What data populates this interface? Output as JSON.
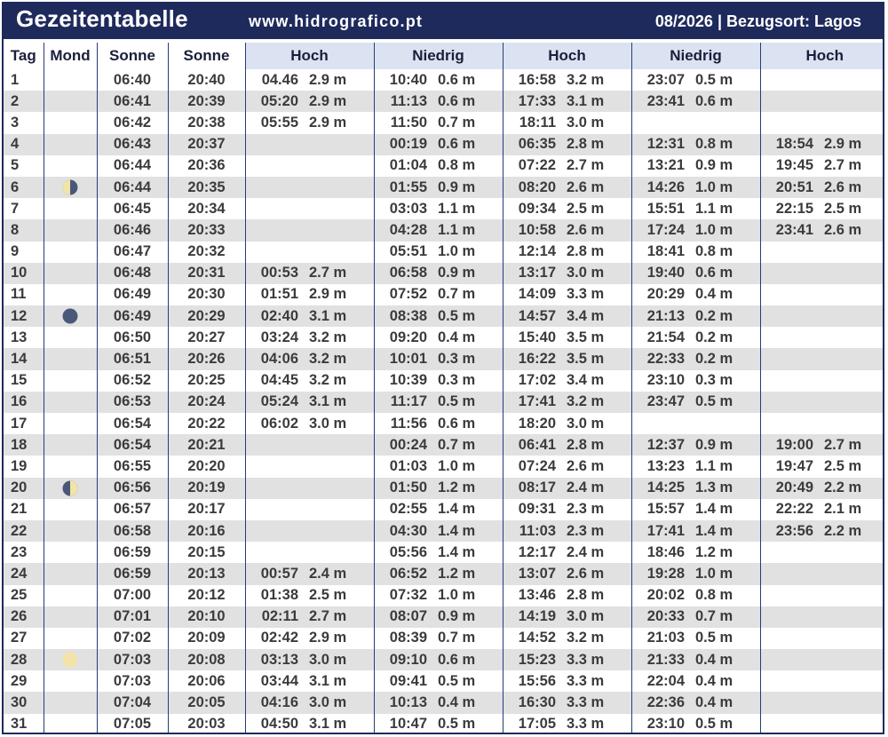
{
  "header": {
    "title": "Gezeitentabelle",
    "website": "www.hidrografico.pt",
    "info": "08/2026 | Bezugsort: Lagos"
  },
  "columns": [
    "Tag",
    "Mond",
    "Sonne",
    "Sonne",
    "Hoch",
    "Niedrig",
    "Hoch",
    "Niedrig",
    "Hoch"
  ],
  "colors": {
    "navy": "#1e2a5c",
    "header_bg": "#dbe3f2",
    "row_alt": "#e1e1e1",
    "moon_dark": "#4a5878",
    "moon_light": "#f2e3a8"
  },
  "rows": [
    {
      "day": "1",
      "moon": "",
      "sunrise": "06:40",
      "sunset": "20:40",
      "tides": [
        [
          "04.46",
          "2.9 m"
        ],
        [
          "10:40",
          "0.6 m"
        ],
        [
          "16:58",
          "3.2 m"
        ],
        [
          "23:07",
          "0.5 m"
        ],
        [
          "",
          ""
        ]
      ]
    },
    {
      "day": "2",
      "moon": "",
      "sunrise": "06:41",
      "sunset": "20:39",
      "tides": [
        [
          "05:20",
          "2.9 m"
        ],
        [
          "11:13",
          "0.6 m"
        ],
        [
          "17:33",
          "3.1 m"
        ],
        [
          "23:41",
          "0.6 m"
        ],
        [
          "",
          ""
        ]
      ]
    },
    {
      "day": "3",
      "moon": "",
      "sunrise": "06:42",
      "sunset": "20:38",
      "tides": [
        [
          "05:55",
          "2.9 m"
        ],
        [
          "11:50",
          "0.7 m"
        ],
        [
          "18:11",
          "3.0 m"
        ],
        [
          "",
          ""
        ],
        [
          "",
          ""
        ]
      ]
    },
    {
      "day": "4",
      "moon": "",
      "sunrise": "06:43",
      "sunset": "20:37",
      "tides": [
        [
          "",
          ""
        ],
        [
          "00:19",
          "0.6 m"
        ],
        [
          "06:35",
          "2.8 m"
        ],
        [
          "12:31",
          "0.8 m"
        ],
        [
          "18:54",
          "2.9 m"
        ]
      ]
    },
    {
      "day": "5",
      "moon": "",
      "sunrise": "06:44",
      "sunset": "20:36",
      "tides": [
        [
          "",
          ""
        ],
        [
          "01:04",
          "0.8 m"
        ],
        [
          "07:22",
          "2.7 m"
        ],
        [
          "13:21",
          "0.9 m"
        ],
        [
          "19:45",
          "2.7 m"
        ]
      ]
    },
    {
      "day": "6",
      "moon": "last-quarter",
      "sunrise": "06:44",
      "sunset": "20:35",
      "tides": [
        [
          "",
          ""
        ],
        [
          "01:55",
          "0.9 m"
        ],
        [
          "08:20",
          "2.6 m"
        ],
        [
          "14:26",
          "1.0 m"
        ],
        [
          "20:51",
          "2.6 m"
        ]
      ]
    },
    {
      "day": "7",
      "moon": "",
      "sunrise": "06:45",
      "sunset": "20:34",
      "tides": [
        [
          "",
          ""
        ],
        [
          "03:03",
          "1.1 m"
        ],
        [
          "09:34",
          "2.5 m"
        ],
        [
          "15:51",
          "1.1 m"
        ],
        [
          "22:15",
          "2.5 m"
        ]
      ]
    },
    {
      "day": "8",
      "moon": "",
      "sunrise": "06:46",
      "sunset": "20:33",
      "tides": [
        [
          "",
          ""
        ],
        [
          "04:28",
          "1.1 m"
        ],
        [
          "10:58",
          "2.6 m"
        ],
        [
          "17:24",
          "1.0 m"
        ],
        [
          "23:41",
          "2.6 m"
        ]
      ]
    },
    {
      "day": "9",
      "moon": "",
      "sunrise": "06:47",
      "sunset": "20:32",
      "tides": [
        [
          "",
          ""
        ],
        [
          "05:51",
          "1.0 m"
        ],
        [
          "12:14",
          "2.8 m"
        ],
        [
          "18:41",
          "0.8 m"
        ],
        [
          "",
          ""
        ]
      ]
    },
    {
      "day": "10",
      "moon": "",
      "sunrise": "06:48",
      "sunset": "20:31",
      "tides": [
        [
          "00:53",
          "2.7 m"
        ],
        [
          "06:58",
          "0.9 m"
        ],
        [
          "13:17",
          "3.0 m"
        ],
        [
          "19:40",
          "0.6 m"
        ],
        [
          "",
          ""
        ]
      ]
    },
    {
      "day": "11",
      "moon": "",
      "sunrise": "06:49",
      "sunset": "20:30",
      "tides": [
        [
          "01:51",
          "2.9 m"
        ],
        [
          "07:52",
          "0.7 m"
        ],
        [
          "14:09",
          "3.3 m"
        ],
        [
          "20:29",
          "0.4 m"
        ],
        [
          "",
          ""
        ]
      ]
    },
    {
      "day": "12",
      "moon": "new",
      "sunrise": "06:49",
      "sunset": "20:29",
      "tides": [
        [
          "02:40",
          "3.1 m"
        ],
        [
          "08:38",
          "0.5 m"
        ],
        [
          "14:57",
          "3.4 m"
        ],
        [
          "21:13",
          "0.2 m"
        ],
        [
          "",
          ""
        ]
      ]
    },
    {
      "day": "13",
      "moon": "",
      "sunrise": "06:50",
      "sunset": "20:27",
      "tides": [
        [
          "03:24",
          "3.2 m"
        ],
        [
          "09:20",
          "0.4 m"
        ],
        [
          "15:40",
          "3.5 m"
        ],
        [
          "21:54",
          "0.2 m"
        ],
        [
          "",
          ""
        ]
      ]
    },
    {
      "day": "14",
      "moon": "",
      "sunrise": "06:51",
      "sunset": "20:26",
      "tides": [
        [
          "04:06",
          "3.2 m"
        ],
        [
          "10:01",
          "0.3 m"
        ],
        [
          "16:22",
          "3.5 m"
        ],
        [
          "22:33",
          "0.2 m"
        ],
        [
          "",
          ""
        ]
      ]
    },
    {
      "day": "15",
      "moon": "",
      "sunrise": "06:52",
      "sunset": "20:25",
      "tides": [
        [
          "04:45",
          "3.2 m"
        ],
        [
          "10:39",
          "0.3 m"
        ],
        [
          "17:02",
          "3.4 m"
        ],
        [
          "23:10",
          "0.3 m"
        ],
        [
          "",
          ""
        ]
      ]
    },
    {
      "day": "16",
      "moon": "",
      "sunrise": "06:53",
      "sunset": "20:24",
      "tides": [
        [
          "05:24",
          "3.1 m"
        ],
        [
          "11:17",
          "0.5 m"
        ],
        [
          "17:41",
          "3.2 m"
        ],
        [
          "23:47",
          "0.5 m"
        ],
        [
          "",
          ""
        ]
      ]
    },
    {
      "day": "17",
      "moon": "",
      "sunrise": "06:54",
      "sunset": "20:22",
      "tides": [
        [
          "06:02",
          "3.0 m"
        ],
        [
          "11:56",
          "0.6 m"
        ],
        [
          "18:20",
          "3.0 m"
        ],
        [
          "",
          ""
        ],
        [
          "",
          ""
        ]
      ]
    },
    {
      "day": "18",
      "moon": "",
      "sunrise": "06:54",
      "sunset": "20:21",
      "tides": [
        [
          "",
          ""
        ],
        [
          "00:24",
          "0.7 m"
        ],
        [
          "06:41",
          "2.8 m"
        ],
        [
          "12:37",
          "0.9 m"
        ],
        [
          "19:00",
          "2.7 m"
        ]
      ]
    },
    {
      "day": "19",
      "moon": "",
      "sunrise": "06:55",
      "sunset": "20:20",
      "tides": [
        [
          "",
          ""
        ],
        [
          "01:03",
          "1.0 m"
        ],
        [
          "07:24",
          "2.6 m"
        ],
        [
          "13:23",
          "1.1 m"
        ],
        [
          "19:47",
          "2.5 m"
        ]
      ]
    },
    {
      "day": "20",
      "moon": "first-quarter",
      "sunrise": "06:56",
      "sunset": "20:19",
      "tides": [
        [
          "",
          ""
        ],
        [
          "01:50",
          "1.2 m"
        ],
        [
          "08:17",
          "2.4 m"
        ],
        [
          "14:25",
          "1.3 m"
        ],
        [
          "20:49",
          "2.2 m"
        ]
      ]
    },
    {
      "day": "21",
      "moon": "",
      "sunrise": "06:57",
      "sunset": "20:17",
      "tides": [
        [
          "",
          ""
        ],
        [
          "02:55",
          "1.4 m"
        ],
        [
          "09:31",
          "2.3 m"
        ],
        [
          "15:57",
          "1.4 m"
        ],
        [
          "22:22",
          "2.1 m"
        ]
      ]
    },
    {
      "day": "22",
      "moon": "",
      "sunrise": "06:58",
      "sunset": "20:16",
      "tides": [
        [
          "",
          ""
        ],
        [
          "04:30",
          "1.4 m"
        ],
        [
          "11:03",
          "2.3 m"
        ],
        [
          "17:41",
          "1.4 m"
        ],
        [
          "23:56",
          "2.2 m"
        ]
      ]
    },
    {
      "day": "23",
      "moon": "",
      "sunrise": "06:59",
      "sunset": "20:15",
      "tides": [
        [
          "",
          ""
        ],
        [
          "05:56",
          "1.4 m"
        ],
        [
          "12:17",
          "2.4 m"
        ],
        [
          "18:46",
          "1.2 m"
        ],
        [
          "",
          ""
        ]
      ]
    },
    {
      "day": "24",
      "moon": "",
      "sunrise": "06:59",
      "sunset": "20:13",
      "tides": [
        [
          "00:57",
          "2.4 m"
        ],
        [
          "06:52",
          "1.2 m"
        ],
        [
          "13:07",
          "2.6 m"
        ],
        [
          "19:28",
          "1.0 m"
        ],
        [
          "",
          ""
        ]
      ]
    },
    {
      "day": "25",
      "moon": "",
      "sunrise": "07:00",
      "sunset": "20:12",
      "tides": [
        [
          "01:38",
          "2.5 m"
        ],
        [
          "07:32",
          "1.0 m"
        ],
        [
          "13:46",
          "2.8 m"
        ],
        [
          "20:02",
          "0.8 m"
        ],
        [
          "",
          ""
        ]
      ]
    },
    {
      "day": "26",
      "moon": "",
      "sunrise": "07:01",
      "sunset": "20:10",
      "tides": [
        [
          "02:11",
          "2.7 m"
        ],
        [
          "08:07",
          "0.9 m"
        ],
        [
          "14:19",
          "3.0 m"
        ],
        [
          "20:33",
          "0.7 m"
        ],
        [
          "",
          ""
        ]
      ]
    },
    {
      "day": "27",
      "moon": "",
      "sunrise": "07:02",
      "sunset": "20:09",
      "tides": [
        [
          "02:42",
          "2.9 m"
        ],
        [
          "08:39",
          "0.7 m"
        ],
        [
          "14:52",
          "3.2 m"
        ],
        [
          "21:03",
          "0.5 m"
        ],
        [
          "",
          ""
        ]
      ]
    },
    {
      "day": "28",
      "moon": "full",
      "sunrise": "07:03",
      "sunset": "20:08",
      "tides": [
        [
          "03:13",
          "3.0 m"
        ],
        [
          "09:10",
          "0.6 m"
        ],
        [
          "15:23",
          "3.3 m"
        ],
        [
          "21:33",
          "0.4 m"
        ],
        [
          "",
          ""
        ]
      ]
    },
    {
      "day": "29",
      "moon": "",
      "sunrise": "07:03",
      "sunset": "20:06",
      "tides": [
        [
          "03:44",
          "3.1 m"
        ],
        [
          "09:41",
          "0.5 m"
        ],
        [
          "15:56",
          "3.3 m"
        ],
        [
          "22:04",
          "0.4 m"
        ],
        [
          "",
          ""
        ]
      ]
    },
    {
      "day": "30",
      "moon": "",
      "sunrise": "07:04",
      "sunset": "20:05",
      "tides": [
        [
          "04:16",
          "3.0 m"
        ],
        [
          "10:13",
          "0.4 m"
        ],
        [
          "16:30",
          "3.3 m"
        ],
        [
          "22:36",
          "0.4 m"
        ],
        [
          "",
          ""
        ]
      ]
    },
    {
      "day": "31",
      "moon": "",
      "sunrise": "07:05",
      "sunset": "20:03",
      "tides": [
        [
          "04:50",
          "3.1 m"
        ],
        [
          "10:47",
          "0.5 m"
        ],
        [
          "17:05",
          "3.3 m"
        ],
        [
          "23:10",
          "0.5 m"
        ],
        [
          "",
          ""
        ]
      ]
    }
  ]
}
